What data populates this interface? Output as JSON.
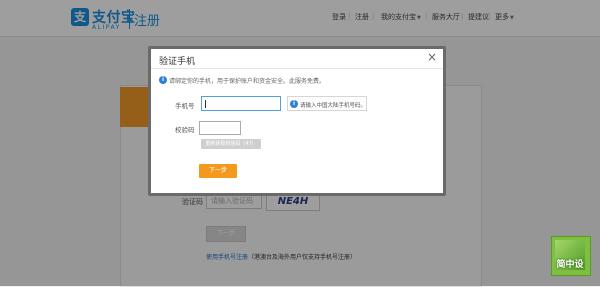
{
  "header": {
    "logo_mark": "支",
    "logo_cn": "支付宝",
    "logo_en": "ALIPAY",
    "page_label": "注册",
    "nav": {
      "login": "登录",
      "register": "注册",
      "my_alipay": "我的支付宝",
      "service_hall": "服务大厅",
      "suggestion": "提建议",
      "more": "更多"
    }
  },
  "background_form": {
    "captcha_label": "验证码",
    "captcha_placeholder": "请输入验证码",
    "captcha_image_text": "NE4H",
    "next_label": "下一步",
    "phone_register_link": "使用手机号注册",
    "phone_register_note": "（港澳台及海外用户仅支持手机号注册）"
  },
  "modal": {
    "title": "验证手机",
    "notice": "请绑定你的手机，用于保护账户和资金安全。此服务免费。",
    "phone_label": "手机号",
    "phone_value": "",
    "phone_tip": "请输入中国大陆手机号码。",
    "code_label": "校验码",
    "code_value": "",
    "resend_label": "重新获取校验码（47）",
    "next_label": "下一步"
  },
  "widget": {
    "label": "简中设"
  }
}
